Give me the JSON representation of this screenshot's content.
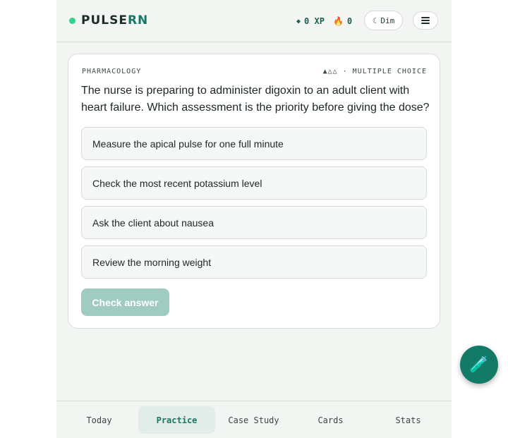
{
  "header": {
    "brand_main": "PULSE",
    "brand_accent": "RN",
    "xp_text": "0 XP",
    "streak_text": "0",
    "dim_label": "Dim",
    "icons": {
      "xp": "diamond-icon",
      "streak": "flame-icon",
      "dim": "moon-icon",
      "menu": "menu-icon"
    },
    "colors": {
      "accent": "#137a67",
      "status_dot": "#34d08e"
    }
  },
  "question_card": {
    "category": "PHARMACOLOGY",
    "difficulty_type": "▲△△ · MULTIPLE CHOICE",
    "question": "The nurse is preparing to administer digoxin to an adult client with heart failure. Which assessment is the priority before giving the dose?",
    "options": [
      "Measure the apical pulse for one full minute",
      "Check the most recent potassium level",
      "Ask the client about nausea",
      "Review the morning weight"
    ],
    "check_label": "Check answer"
  },
  "fab": {
    "icon": "test-tube-icon"
  },
  "nav": {
    "items": [
      {
        "label": "Today"
      },
      {
        "label": "Practice",
        "active": true
      },
      {
        "label": "Case Study"
      },
      {
        "label": "Cards"
      },
      {
        "label": "Stats"
      }
    ]
  }
}
